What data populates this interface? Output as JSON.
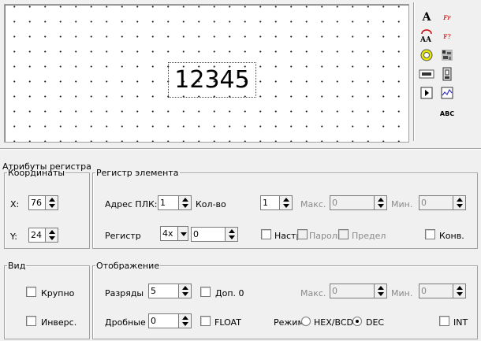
{
  "canvas": {
    "display_value": "12345"
  },
  "toolbar": {
    "abc_label": "ABC"
  },
  "register_attrs": {
    "title": "Атрибуты регистра",
    "coords": {
      "legend": "Координаты",
      "x_label": "X:",
      "x_value": "76",
      "y_label": "Y:",
      "y_value": "24"
    },
    "element_register": {
      "legend": "Регистр элемента",
      "plc_addr_label": "Адрес ПЛК:",
      "plc_addr_value": "1",
      "count_label": "Кол-во",
      "count_value": "1",
      "max_label": "Макс.",
      "max_value": "0",
      "min_label": "Мин.",
      "min_value": "0",
      "register_label": "Регистр",
      "register_type": "4x",
      "register_value": "0",
      "setup_label": "Настр",
      "password_label": "Пароль",
      "limit_label": "Предел",
      "conv_label": "Конв."
    },
    "view": {
      "legend": "Вид",
      "large_label": "Крупно",
      "invert_label": "Инверс."
    },
    "display": {
      "legend": "Отображение",
      "digits_label": "Разряды",
      "digits_value": "5",
      "add_zero_label": "Доп. 0",
      "max_label": "Макс.",
      "max_value": "0",
      "min_label": "Мин.",
      "min_value": "0",
      "fraction_label": "Дробные",
      "fraction_value": "0",
      "float_label": "FLOAT",
      "mode_label": "Режим:",
      "hex_label": "HEX/BCD",
      "dec_label": "DEC",
      "dec_selected": true,
      "int_label": "INT"
    }
  }
}
